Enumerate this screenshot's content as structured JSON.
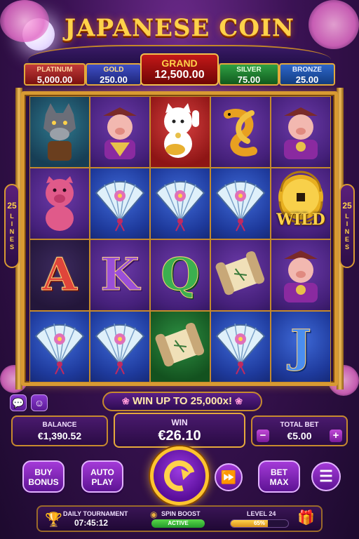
{
  "title": "JAPANESE COIN",
  "jackpots": {
    "platinum": {
      "label": "PLATINUM",
      "value": "5,000.00"
    },
    "gold": {
      "label": "GOLD",
      "value": "250.00"
    },
    "grand": {
      "label": "GRAND",
      "value": "12,500.00"
    },
    "silver": {
      "label": "SILVER",
      "value": "75.00"
    },
    "bronze": {
      "label": "BRONZE",
      "value": "25.00"
    }
  },
  "lines": {
    "count": "25",
    "label": [
      "L",
      "I",
      "N",
      "E",
      "S"
    ]
  },
  "reels": [
    [
      {
        "symbol": "wolf",
        "bg": "teal"
      },
      {
        "symbol": "pig-fan",
        "bg": "purple"
      },
      {
        "symbol": "lucky-cat",
        "bg": "red"
      },
      {
        "symbol": "koi-fish",
        "bg": "purple"
      },
      {
        "symbol": "pig-coin",
        "bg": "purple"
      }
    ],
    [
      {
        "symbol": "knitted-pig",
        "bg": "purple"
      },
      {
        "symbol": "fan",
        "bg": "blue"
      },
      {
        "symbol": "fan",
        "bg": "blue"
      },
      {
        "symbol": "fan",
        "bg": "blue"
      },
      {
        "symbol": "wild",
        "bg": "purple",
        "text": "WILD"
      }
    ],
    [
      {
        "symbol": "letter",
        "bg": "dark",
        "text": "A"
      },
      {
        "symbol": "letter",
        "bg": "purple",
        "text": "K"
      },
      {
        "symbol": "letter",
        "bg": "purple",
        "text": "Q"
      },
      {
        "symbol": "scroll",
        "bg": "purple"
      },
      {
        "symbol": "pig-coin",
        "bg": "purple"
      }
    ],
    [
      {
        "symbol": "fan",
        "bg": "blue"
      },
      {
        "symbol": "fan",
        "bg": "blue"
      },
      {
        "symbol": "scroll",
        "bg": "green"
      },
      {
        "symbol": "fan",
        "bg": "blue"
      },
      {
        "symbol": "letter",
        "bg": "blue",
        "text": "J"
      }
    ]
  ],
  "banner": {
    "text": "WIN UP TO 25,000x!"
  },
  "balance": {
    "label": "BALANCE",
    "value": "€1,390.52"
  },
  "win": {
    "label": "WIN",
    "value": "€26.10"
  },
  "total_bet": {
    "label": "TOTAL BET",
    "value": "€5.00",
    "minus": "−",
    "plus": "+"
  },
  "controls": {
    "buy_bonus": [
      "BUY",
      "BONUS"
    ],
    "auto_play": [
      "AUTO",
      "PLAY"
    ],
    "bet_max": [
      "BET",
      "MAX"
    ]
  },
  "bottom": {
    "tournament_label": "DAILY TOURNAMENT",
    "tournament_time": "07:45:12",
    "boost_label": "SPIN BOOST",
    "boost_status": "ACTIVE",
    "level_label": "LEVEL 24",
    "level_progress_pct": 65,
    "level_progress_text": "65%"
  },
  "colors": {
    "accent": "#ffd24a",
    "frame": "#d89a32",
    "button": "#a43ad8"
  }
}
